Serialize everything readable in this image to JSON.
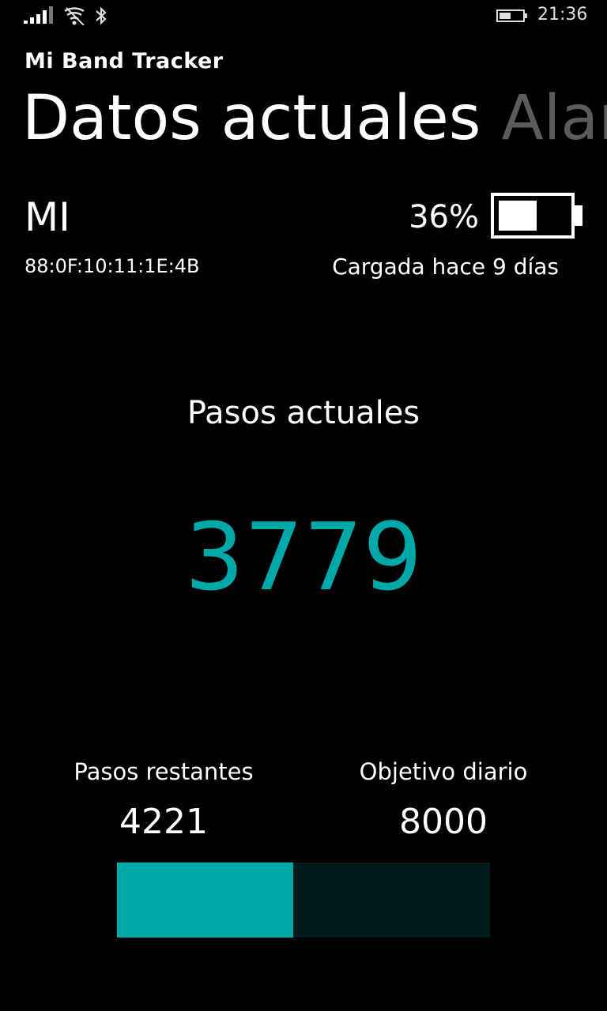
{
  "status_bar": {
    "time": "21:36",
    "icons": [
      "signal-icon",
      "wifi-icon",
      "bluetooth-icon",
      "battery-icon"
    ]
  },
  "app": {
    "title": "Mi Band Tracker"
  },
  "pivot": {
    "current": "Datos actuales",
    "next": "Alarmas"
  },
  "device": {
    "name": "MI",
    "mac": "88:0F:10:11:1E:4B"
  },
  "battery": {
    "percent_text": "36%",
    "level": 0.36,
    "charged_text": "Cargada hace 9 días"
  },
  "steps": {
    "label": "Pasos actuales",
    "value": "3779",
    "remaining_label": "Pasos restantes",
    "remaining_value": "4221",
    "goal_label": "Objetivo diario",
    "goal_value": "8000",
    "progress": 0.472
  },
  "colors": {
    "accent": "#00a9a9",
    "progress_track": "#021c1c",
    "inactive_pivot": "#5b5b5b",
    "background": "#000000"
  }
}
